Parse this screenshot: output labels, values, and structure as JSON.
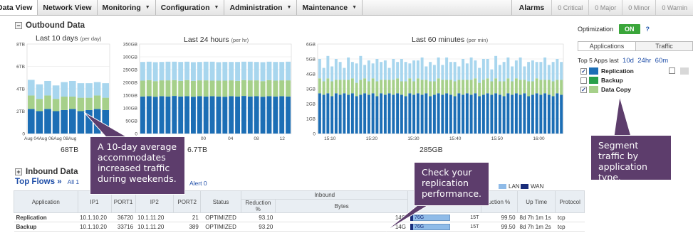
{
  "nav": {
    "tabs": [
      {
        "label": "Data View",
        "dropdown": false
      },
      {
        "label": "Network View",
        "dropdown": false
      },
      {
        "label": "Monitoring",
        "dropdown": true
      },
      {
        "label": "Configuration",
        "dropdown": true
      },
      {
        "label": "Administration",
        "dropdown": true
      },
      {
        "label": "Maintenance",
        "dropdown": true
      }
    ],
    "alarms_label": "Alarms",
    "alarm_counts": [
      "0 Critical",
      "0 Major",
      "0 Minor",
      "0 Warnin"
    ]
  },
  "outbound": {
    "toggle": "−",
    "title": "Outbound Data",
    "charts": [
      {
        "title": "Last 10 days",
        "subtitle": "(per day)",
        "total": "68TB",
        "y_ticks": [
          "8TB",
          "6TB",
          "4TB",
          "2TB",
          "0"
        ],
        "x_ticks": [
          "Aug 04Aug 06Aug 08Aug"
        ]
      },
      {
        "title": "Last 24 hours",
        "subtitle": "(per hr)",
        "total": "6.7TB",
        "y_ticks": [
          "350GB",
          "300GB",
          "250GB",
          "200GB",
          "150GB",
          "100GB",
          "50GB",
          "0"
        ],
        "x_ticks": [
          "00",
          "04",
          "08",
          "12"
        ]
      },
      {
        "title": "Last 60 minutes",
        "subtitle": "(per min)",
        "total": "285GB",
        "y_ticks": [
          "6GB",
          "5GB",
          "4GB",
          "3GB",
          "2GB",
          "1GB",
          "0"
        ],
        "x_ticks": [
          "15:10",
          "15:20",
          "15:30",
          "15:40",
          "15:50",
          "16:00"
        ]
      }
    ]
  },
  "chart_data": [
    {
      "type": "bar",
      "title": "Last 10 days",
      "ylim": [
        0,
        8
      ],
      "series": [
        {
          "name": "Replication",
          "values": [
            2.2,
            2.0,
            2.2,
            2.0,
            2.1,
            2.2,
            2.0,
            2.1,
            2.2,
            2.1
          ]
        },
        {
          "name": "Backup",
          "values": [
            1.2,
            1.1,
            1.2,
            1.1,
            1.2,
            1.1,
            1.2,
            1.1,
            1.2,
            1.1
          ]
        },
        {
          "name": "Data Copy",
          "values": [
            1.4,
            1.3,
            1.3,
            1.2,
            1.3,
            1.4,
            1.3,
            1.3,
            1.2,
            1.3
          ]
        }
      ]
    },
    {
      "type": "bar",
      "title": "Last 24 hours",
      "ylim": [
        0,
        350
      ],
      "series": [
        {
          "name": "Replication",
          "values": [
            145,
            146,
            144,
            146,
            145,
            147,
            145,
            146,
            144,
            146,
            145,
            146,
            145,
            144,
            146,
            145,
            147,
            145,
            146,
            144,
            146,
            145,
            146,
            145
          ]
        },
        {
          "name": "Backup",
          "values": [
            62,
            63,
            61,
            62,
            63,
            62,
            61,
            63,
            62,
            62,
            63,
            61,
            62,
            63,
            62,
            61,
            62,
            63,
            62,
            61,
            63,
            62,
            62,
            63
          ]
        },
        {
          "name": "Data Copy",
          "values": [
            73,
            72,
            74,
            72,
            73,
            72,
            74,
            72,
            73,
            72,
            73,
            74,
            72,
            73,
            72,
            74,
            72,
            73,
            72,
            74,
            72,
            73,
            72,
            73
          ]
        }
      ]
    },
    {
      "type": "bar",
      "title": "Last 60 minutes",
      "ylim": [
        0,
        6
      ],
      "series": [
        {
          "name": "Replication",
          "values": [
            2.7,
            2.6,
            2.7,
            2.5,
            2.7,
            2.6,
            2.7,
            2.6,
            2.7,
            2.5,
            2.6,
            2.7,
            2.6,
            2.7,
            2.5,
            2.7,
            2.6,
            2.7,
            2.6,
            2.7,
            2.6,
            2.5,
            2.7,
            2.6,
            2.7,
            2.6,
            2.7,
            2.5,
            2.6,
            2.7,
            2.6,
            2.7,
            2.6,
            2.5,
            2.7,
            2.6,
            2.7,
            2.6,
            2.7,
            2.5,
            2.6,
            2.7,
            2.6,
            2.7,
            2.6,
            2.5,
            2.7,
            2.6,
            2.7,
            2.6,
            2.7,
            2.5,
            2.6,
            2.7,
            2.6,
            2.7,
            2.6,
            2.5,
            2.7,
            2.6
          ]
        },
        {
          "name": "Backup",
          "values": [
            1.0,
            0.9,
            1.0,
            1.0,
            0.9,
            1.0,
            0.9,
            1.0,
            1.0,
            0.9,
            1.0,
            1.0,
            0.9,
            1.0,
            1.0,
            0.9,
            1.0,
            0.9,
            1.0,
            1.0,
            0.9,
            1.0,
            1.0,
            0.9,
            1.0,
            1.0,
            0.9,
            1.0,
            0.9,
            1.0,
            1.0,
            0.9,
            1.0,
            1.0,
            0.9,
            1.0,
            0.9,
            1.0,
            1.0,
            0.9,
            1.0,
            1.0,
            0.9,
            1.0,
            0.9,
            1.0,
            1.0,
            0.9,
            1.0,
            1.0,
            0.9,
            1.0,
            0.9,
            1.0,
            1.0,
            0.9,
            1.0,
            1.0,
            0.9,
            1.0
          ]
        },
        {
          "name": "Data Copy",
          "values": [
            1.3,
            0.9,
            1.5,
            1.0,
            1.4,
            1.2,
            0.8,
            1.5,
            1.1,
            1.3,
            1.6,
            0.9,
            1.4,
            1.0,
            1.5,
            1.2,
            1.3,
            0.8,
            1.4,
            1.1,
            1.5,
            1.3,
            1.0,
            1.4,
            1.2,
            1.5,
            0.9,
            1.3,
            1.1,
            1.4,
            1.0,
            1.5,
            1.2,
            1.3,
            0.9,
            1.4,
            1.1,
            1.5,
            1.2,
            1.0,
            1.4,
            1.3,
            0.8,
            1.5,
            1.1,
            1.3,
            1.4,
            1.0,
            1.2,
            1.5,
            0.9,
            1.3,
            1.4,
            1.1,
            1.2,
            1.5,
            1.0,
            1.3,
            1.4,
            1.2
          ]
        }
      ]
    }
  ],
  "colors": {
    "replication": "#1c6eb5",
    "backup": "#a6d08a",
    "datacopy": "#a8d6ee",
    "lan": "#8fbbe8",
    "wan": "#1a2d7a",
    "callout": "#5d3d6c",
    "on": "#3aa63a",
    "link": "#1f4ea8"
  },
  "panel": {
    "optimization_label": "Optimization",
    "optimization_state": "ON",
    "help": "?",
    "tabs": [
      "Applications",
      "Traffic"
    ],
    "top5_label": "Top 5 Apps last",
    "ranges": [
      "10d",
      "24hr",
      "60m"
    ],
    "apps": [
      {
        "name": "Replication",
        "checked": true,
        "color": "#1c6eb5"
      },
      {
        "name": "Backup",
        "checked": false,
        "color": "#28a04a"
      },
      {
        "name": "Data Copy",
        "checked": true,
        "color": "#a6d08a"
      }
    ]
  },
  "inbound": {
    "toggle": "+",
    "title": "Inbound Data"
  },
  "flows": {
    "title": "Top Flows »",
    "all_link": "All 1",
    "alert_link": "Alert 0",
    "legend": [
      "LAN",
      "WAN"
    ],
    "headers": {
      "application": "Application",
      "ip1": "IP1",
      "port1": "PORT1",
      "ip2": "IP2",
      "port2": "PORT2",
      "status": "Status",
      "inbound_group": "Inbound",
      "reduction": "Reduction %",
      "bytes": "Bytes",
      "reduction2": "uction %",
      "uptime": "Up Time",
      "protocol": "Protocol"
    },
    "rows": [
      {
        "app": "Replication",
        "ip1": "10.1.10.20",
        "port1": "36720",
        "ip2": "10.1.11.20",
        "port2": "21",
        "status": "OPTIMIZED",
        "reduction": "93.10",
        "in_bytes": "14G",
        "lan_label": "76G",
        "lan_pct": 0.78,
        "out_bytes": "15T",
        "reduction2": "99.50",
        "uptime": "8d 7h 1m 1s",
        "protocol": "tcp"
      },
      {
        "app": "Backup",
        "ip1": "10.1.10.20",
        "port1": "33716",
        "ip2": "10.1.11.20",
        "port2": "389",
        "status": "OPTIMIZED",
        "reduction": "93.20",
        "in_bytes": "14G",
        "lan_label": "76G",
        "lan_pct": 0.78,
        "out_bytes": "15T",
        "reduction2": "99.50",
        "uptime": "8d 7h 1m 2s",
        "protocol": "tcp"
      }
    ]
  },
  "callouts": {
    "weekends": "A 10-day average accommodates increased traffic during weekends.",
    "replication": "Check your replication performance.",
    "segment": "Segment traffic by application type."
  }
}
